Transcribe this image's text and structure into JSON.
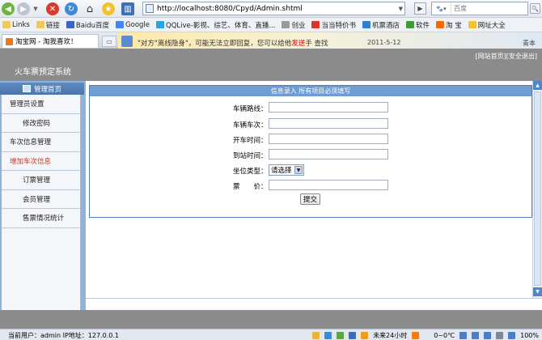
{
  "browser": {
    "address": "http://localhost:8080/Cpyd/Admin.shtml",
    "search_engine": "百度",
    "search_placeholder": "百度",
    "favorites": [
      "Links",
      "链接",
      "Baidu百度",
      "Google",
      "QQLive-影视、综艺、体育、直播...",
      "创业",
      "当当特价书",
      "机票酒店",
      "软件",
      "淘 宝",
      "网址大全"
    ],
    "tab_title": "淘宝网 - 淘我喜欢！",
    "ad_ticker_prefix": "\"对方\"离线",
    "ad_ticker_mid": "隐身",
    "ad_ticker_rest": "\"，可能无法立即回复，您可以给他",
    "ad_ticker_red": "发送手",
    "ad_ticker_more": "查找",
    "ad_date": "2011-5-12",
    "ad_tail": "青本"
  },
  "app": {
    "title": "火车票预定系统",
    "links": [
      "[网站首页]",
      "[安全退出]"
    ]
  },
  "sidebar": {
    "header": "管理首页",
    "items": [
      {
        "label": "管理员设置"
      },
      {
        "label": "修改密码"
      },
      {
        "label": "车次信息管理"
      },
      {
        "label": "增加车次信息"
      },
      {
        "label": "订票管理"
      },
      {
        "label": "会员管理"
      },
      {
        "label": "售票情况统计"
      }
    ]
  },
  "form": {
    "header": "信息录入 所有项目必须填写",
    "fields": [
      {
        "label": "车辆路线：",
        "value": ""
      },
      {
        "label": "车辆车次：",
        "value": ""
      },
      {
        "label": "开车时间：",
        "value": ""
      },
      {
        "label": "到站时间：",
        "value": ""
      },
      {
        "label": "坐位类型：",
        "value": "请选择"
      },
      {
        "label": "票　　价：",
        "value": ""
      }
    ],
    "submit": "提交"
  },
  "status": {
    "user": "当前用户：admin  IP地址：127.0.0.1",
    "time_widget": "未来24小时",
    "weather": "0~0℃",
    "zoom": "100%"
  }
}
